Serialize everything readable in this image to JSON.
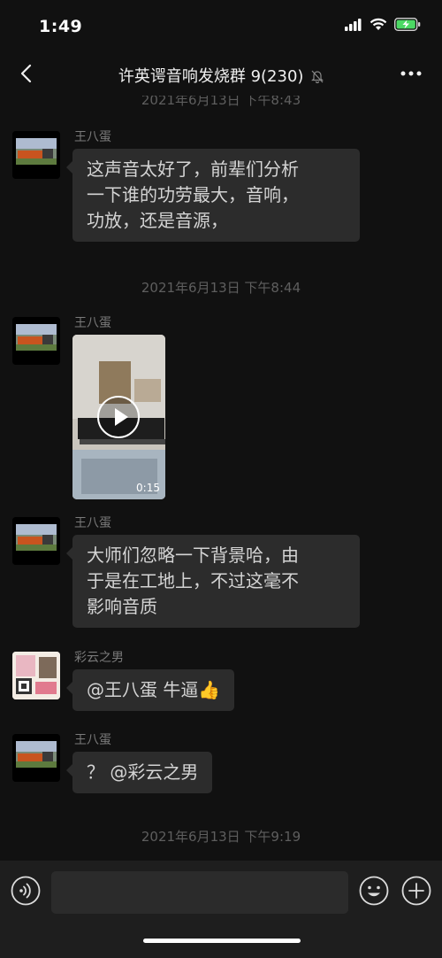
{
  "status": {
    "time": "1:49"
  },
  "nav": {
    "title": "许英谔音响发烧群 9(230)"
  },
  "messages": [
    {
      "sender": "王八蛋",
      "lines": [
        "这声音太好了，前辈们分析",
        "一下谁的功劳最大，音响，",
        "功放，还是音源，"
      ]
    },
    {
      "timestamp": "2021年6月13日 下午8:44"
    },
    {
      "sender": "王八蛋",
      "video": {
        "duration": "0:15"
      }
    },
    {
      "sender": "王八蛋",
      "lines": [
        "大师们忽略一下背景哈，由",
        "于是在工地上，不过这毫不",
        "影响音质"
      ]
    },
    {
      "sender": "彩云之男",
      "lines": [
        "@王八蛋 牛逼👍"
      ]
    },
    {
      "sender": "王八蛋",
      "lines": [
        "？ @彩云之男"
      ]
    },
    {
      "timestamp": "2021年6月13日 下午9:19"
    }
  ],
  "partial_timestamp": "2021年6月13日 下午8:43",
  "input": {
    "value": "",
    "placeholder": ""
  },
  "icons": {
    "back": "chevron-left-icon",
    "mute": "bell-slash-icon",
    "more": "ellipsis-icon",
    "voice": "voice-icon",
    "emoji": "emoji-icon",
    "plus": "plus-icon",
    "play": "play-icon"
  },
  "colors": {
    "background": "#111111",
    "bubble": "#2c2c2c",
    "input_bar": "#1e1e1e"
  }
}
